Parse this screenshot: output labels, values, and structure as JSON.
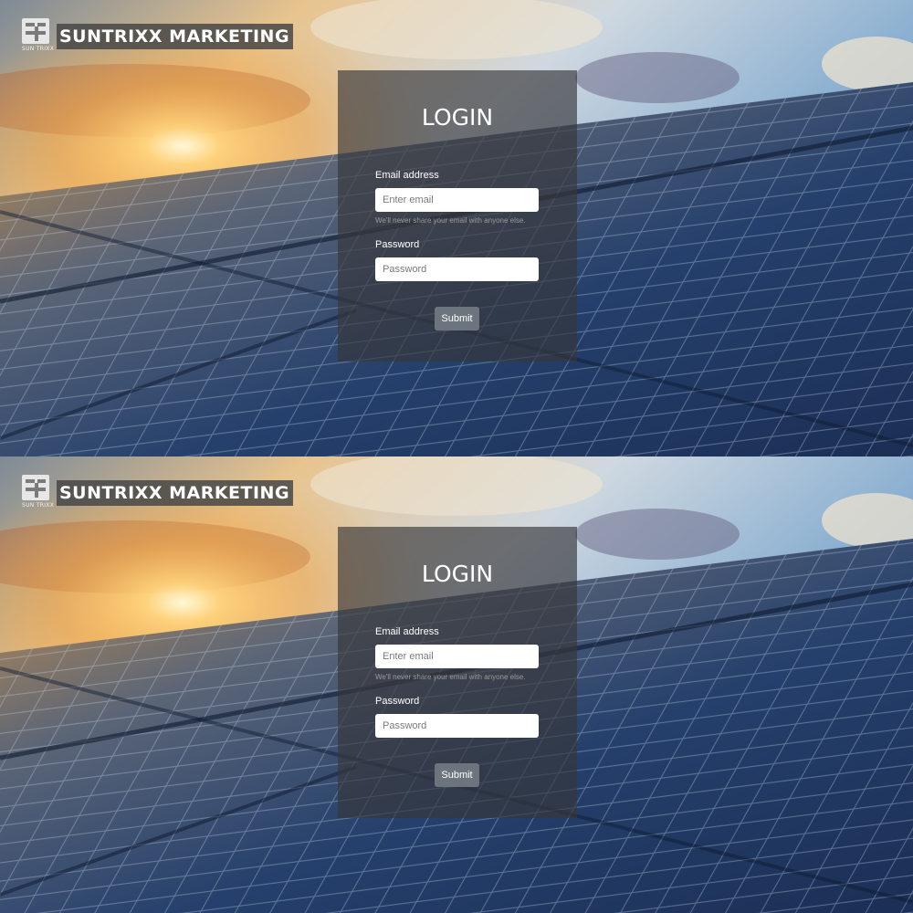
{
  "brand": {
    "logo_caption": "SUN TRIXX",
    "name": "SUNTRIXX MARKETING"
  },
  "login": {
    "title": "LOGIN",
    "email_label": "Email address",
    "email_placeholder": "Enter email",
    "email_value": "",
    "email_help": "We'll never share your email with anyone else.",
    "password_label": "Password",
    "password_placeholder": "Password",
    "password_value": "",
    "submit_label": "Submit"
  },
  "colors": {
    "card_bg": "rgba(55,55,58,0.66)",
    "submit_bg": "#6c757d",
    "brand_bg": "#464646"
  }
}
